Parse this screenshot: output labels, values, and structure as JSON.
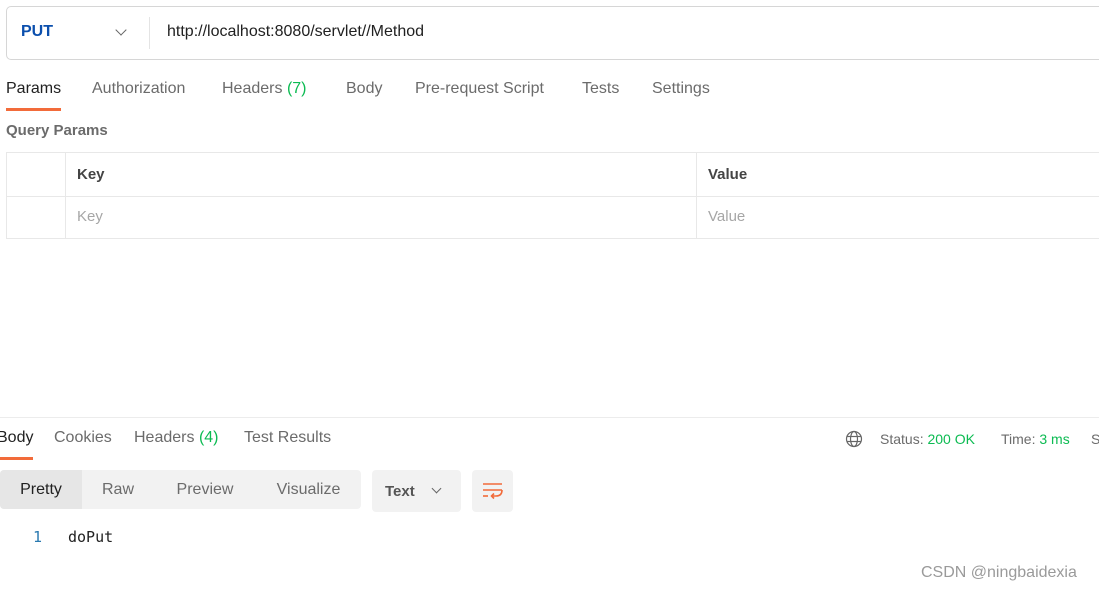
{
  "request": {
    "method": "PUT",
    "url": "http://localhost:8080/servlet//Method"
  },
  "request_tabs": [
    {
      "label": "Params"
    },
    {
      "label": "Authorization"
    },
    {
      "label": "Headers",
      "count": "(7)"
    },
    {
      "label": "Body"
    },
    {
      "label": "Pre-request Script"
    },
    {
      "label": "Tests"
    },
    {
      "label": "Settings"
    }
  ],
  "query_params": {
    "title": "Query Params",
    "columns": [
      "Key",
      "Value"
    ],
    "placeholders": {
      "key": "Key",
      "value": "Value"
    }
  },
  "response_tabs": [
    {
      "label": "Body"
    },
    {
      "label": "Cookies"
    },
    {
      "label": "Headers",
      "count": "(4)"
    },
    {
      "label": "Test Results"
    }
  ],
  "status": {
    "status_label": "Status:",
    "status_value": "200 OK",
    "time_label": "Time:",
    "time_value": "3 ms",
    "size_label_partial": "S"
  },
  "view_modes": [
    "Pretty",
    "Raw",
    "Preview",
    "Visualize"
  ],
  "format": "Text",
  "response_body": [
    {
      "line": "1",
      "text": "doPut"
    }
  ],
  "watermark": "CSDN @ningbaidexia",
  "colors": {
    "accent": "#f26b3a",
    "method": "#0b4fad",
    "success": "#0cbb52",
    "count": "#0cbb52"
  }
}
